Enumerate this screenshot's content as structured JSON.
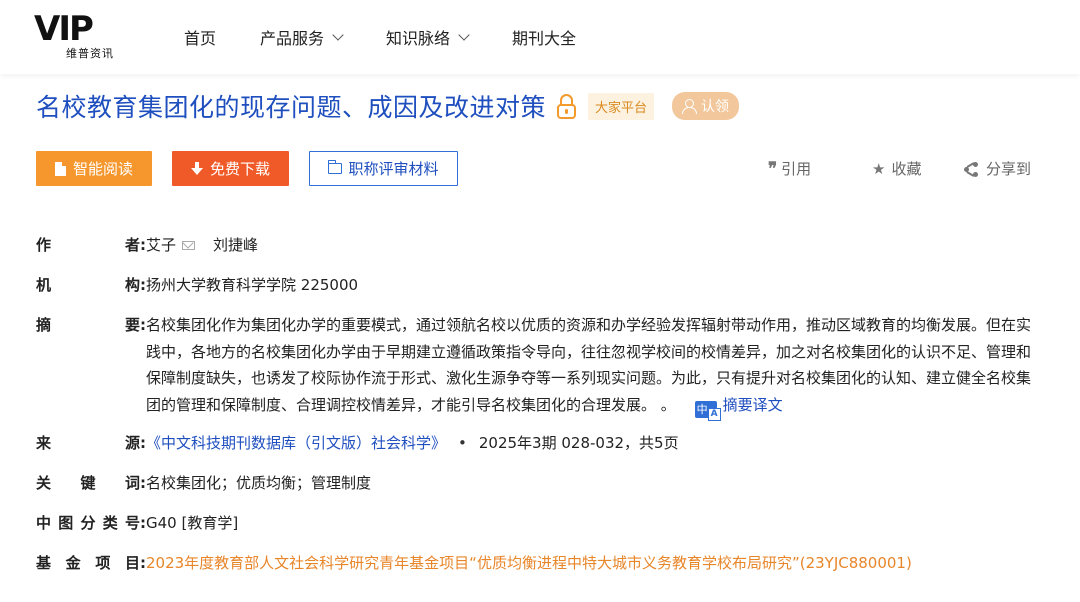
{
  "header": {
    "logo_mark": "VIP",
    "logo_sub": "维普资讯",
    "nav": [
      {
        "label": "首页",
        "has_dropdown": false
      },
      {
        "label": "产品服务",
        "has_dropdown": true
      },
      {
        "label": "知识脉络",
        "has_dropdown": true
      },
      {
        "label": "期刊大全",
        "has_dropdown": false
      }
    ]
  },
  "article": {
    "title": "名校教育集团化的现存问题、成因及改进对策",
    "badge_platform": "大家平台",
    "badge_claim": "认领"
  },
  "actions": {
    "read": "智能阅读",
    "download": "免费下载",
    "title_material": "职称评审材料",
    "cite": "引用",
    "favorite": "收藏",
    "share": "分享到"
  },
  "meta": {
    "authors_label": "作者:",
    "author1": "艾子",
    "author2": "刘捷峰",
    "org_label": "机构:",
    "org": "扬州大学教育科学学院 225000",
    "abstract_label": "摘要:",
    "abstract": "名校集团化作为集团化办学的重要模式，通过领航名校以优质的资源和办学经验发挥辐射带动作用，推动区域教育的均衡发展。但在实践中，各地方的名校集团化办学由于早期建立遵循政策指令导向，往往忽视学校间的校情差异，加之对名校集团化的认识不足、管理和保障制度缺失，也诱发了校际协作流于形式、激化生源争夺等一系列现实问题。为此，只有提升对名校集团化的认知、建立健全名校集团的管理和保障制度、合理调控校情差异，才能引导名校集团化的合理发展。 。",
    "abstract_translate": "摘要译文",
    "source_label": "来源:",
    "source_journal": "《中文科技期刊数据库（引文版）社会科学》",
    "source_issue": "2025年3期 028-032，共5页",
    "keywords_label": "关键词:",
    "keywords": "名校集团化；优质均衡；管理制度",
    "clc_label": "中图分类号:",
    "clc": "G40 [教育学]",
    "fund_label": "基金项目:",
    "fund": "2023年度教育部人文社会科学研究青年基金项目“优质均衡进程中特大城市义务教育学校布局研究”(23YJC880001)"
  },
  "colors": {
    "title_blue": "#1f4fbf",
    "read_orange": "#f5972c",
    "download_red_orange": "#f05a28",
    "fund_orange": "#e8862a"
  }
}
